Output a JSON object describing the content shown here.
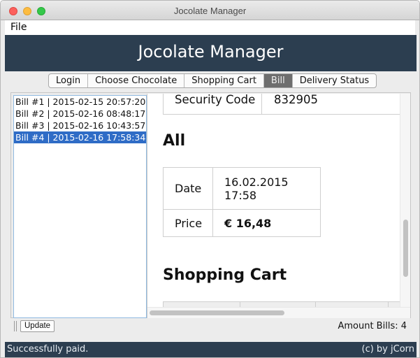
{
  "window": {
    "title": "Jocolate Manager"
  },
  "menu": {
    "file": "File"
  },
  "header": {
    "title": "Jocolate Manager"
  },
  "tabs": [
    {
      "label": "Login",
      "selected": false
    },
    {
      "label": "Choose Chocolate",
      "selected": false
    },
    {
      "label": "Shopping Cart",
      "selected": false
    },
    {
      "label": "Bill",
      "selected": true
    },
    {
      "label": "Delivery Status",
      "selected": false
    }
  ],
  "bills": [
    {
      "label": "Bill #1 | 2015-02-15 20:57:20",
      "selected": false
    },
    {
      "label": "Bill #2 | 2015-02-16 08:48:17",
      "selected": false
    },
    {
      "label": "Bill #3 | 2015-02-16 10:43:57",
      "selected": false
    },
    {
      "label": "Bill #4 | 2015-02-16 17:58:34",
      "selected": true
    }
  ],
  "detail": {
    "security": {
      "label": "Security Code",
      "value": "832905"
    },
    "all_heading": "All",
    "date": {
      "label": "Date",
      "value": "16.02.2015 17:58"
    },
    "price": {
      "label": "Price",
      "value": "€ 16,48"
    },
    "cart_heading": "Shopping Cart"
  },
  "bottom": {
    "update_label": "Update",
    "amount": "Amount Bills: 4"
  },
  "status": {
    "message": "Successfully paid.",
    "copyright": "(c) by jCorn"
  },
  "colors": {
    "header": "#2c3e50",
    "selection": "#2f6cc6",
    "status_bar": "#2c3e50"
  }
}
